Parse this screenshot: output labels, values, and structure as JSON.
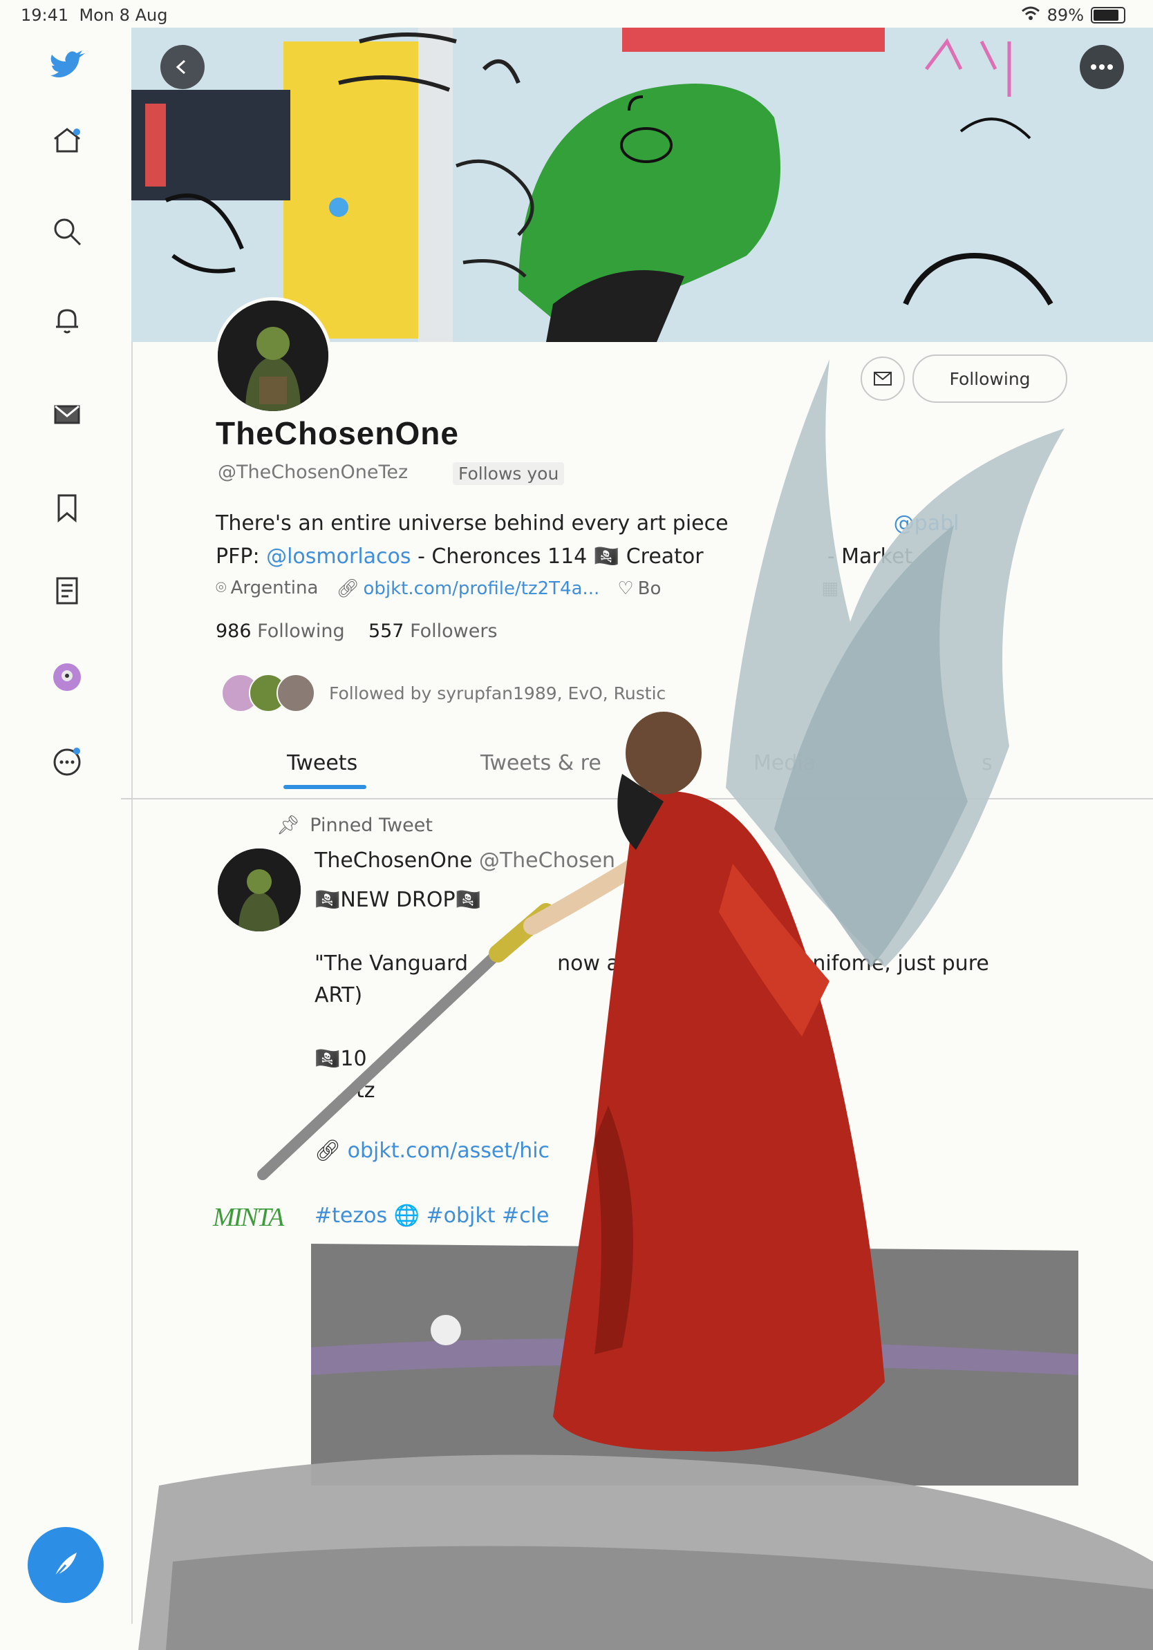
{
  "status": {
    "time": "19:41",
    "date": "Mon 8 Aug",
    "battery_percent": "89%",
    "battery_level": 0.89
  },
  "sidebar": {
    "items": [
      {
        "icon": "twitter-bird-icon"
      },
      {
        "icon": "home-icon"
      },
      {
        "icon": "search-icon"
      },
      {
        "icon": "notifications-bell-icon"
      },
      {
        "icon": "messages-icon"
      },
      {
        "icon": "bookmark-icon"
      },
      {
        "icon": "lists-icon"
      },
      {
        "icon": "profile-avatar-icon"
      },
      {
        "icon": "more-icon"
      }
    ],
    "compose_icon": "compose-feather-icon"
  },
  "profile": {
    "name": "TheChosenOne",
    "handle": "@TheChosenOneTez",
    "follows_you": "Follows you",
    "following_button": "Following",
    "bio_line1_text": "There's an entire universe behind every art piece",
    "bio_line1_mention": "@pabl",
    "bio_line2_prefix": "PFP: ",
    "bio_line2_mention": "@losmorlacos",
    "bio_line2_text": " - Cheronces 114 🏴‍☠️ Creator",
    "bio_line2_tail": "- Market",
    "location": "Argentina",
    "website": "objkt.com/profile/tz2T4a...",
    "born": "Bo",
    "following_count": "986",
    "following_label": "Following",
    "followers_count": "557",
    "followers_label": "Followers",
    "followed_by": "Followed by syrupfan1989, EvO, Rustic"
  },
  "tabs": [
    "Tweets",
    "Tweets & re",
    "Media",
    "s"
  ],
  "pinned": {
    "label": "Pinned Tweet",
    "author": "TheChosenOne",
    "author_handle": "@TheChosen",
    "line1": "🏴‍☠️NEW DROP🏴‍☠️",
    "line2a": "\"The Vanguard",
    "line2b": "now avail",
    "line2c": "denifome, just pure",
    "line3": "ART)",
    "line4": "🏴‍☠️10",
    "line5": "tz",
    "link": "objkt.com/asset/hic",
    "tags": "#tezos 🌐 #objkt #cle",
    "signature": "MINTA"
  },
  "colors": {
    "accent": "#2f8fe0",
    "link": "#3f8fd8",
    "robe": "#b8261a"
  }
}
